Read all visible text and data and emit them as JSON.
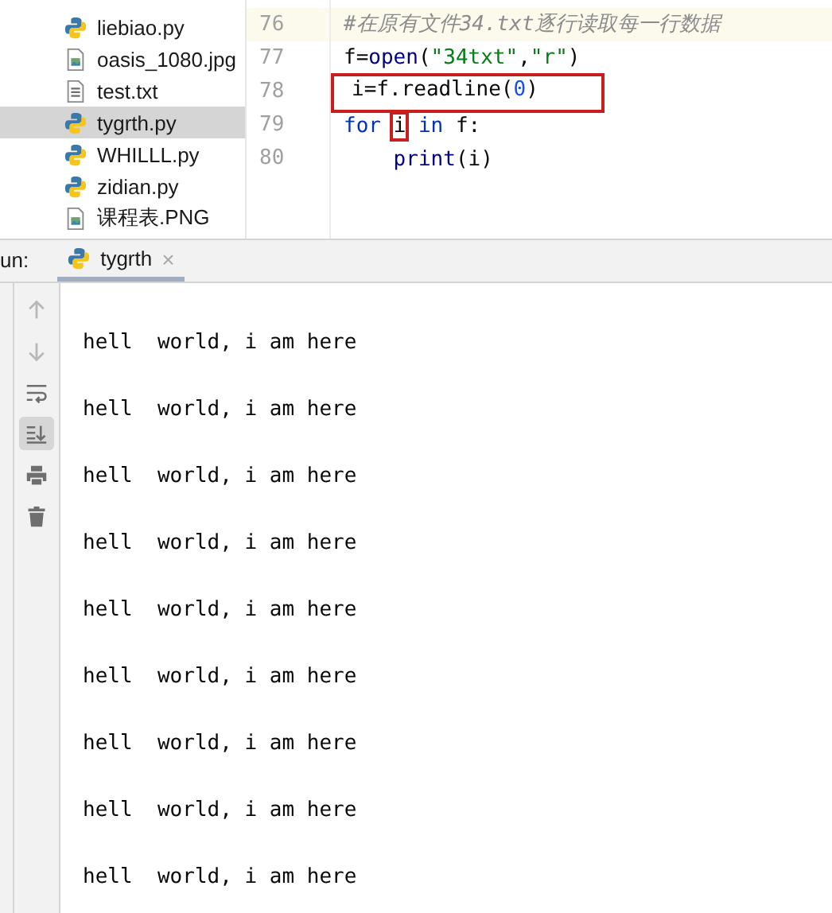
{
  "file_tree": {
    "items": [
      {
        "name": "liebiao.py",
        "kind": "python",
        "selected": false
      },
      {
        "name": "oasis_1080.jpg",
        "kind": "image",
        "selected": false
      },
      {
        "name": "test.txt",
        "kind": "text",
        "selected": false
      },
      {
        "name": "tygrth.py",
        "kind": "python",
        "selected": true
      },
      {
        "name": "WHILLL.py",
        "kind": "python",
        "selected": false
      },
      {
        "name": "zidian.py",
        "kind": "python",
        "selected": false
      },
      {
        "name": "课程表.PNG",
        "kind": "image",
        "selected": false
      }
    ]
  },
  "editor": {
    "lines": [
      {
        "number": "76",
        "current": true,
        "boxed": false,
        "tokens": [
          {
            "kind": "comment",
            "text": "#在原有文件34.txt逐行读取每一行数据",
            "boxed": false
          }
        ]
      },
      {
        "number": "77",
        "current": false,
        "boxed": false,
        "tokens": [
          {
            "kind": "plain",
            "text": "f=",
            "boxed": false
          },
          {
            "kind": "builtin",
            "text": "open",
            "boxed": false
          },
          {
            "kind": "plain",
            "text": "(",
            "boxed": false
          },
          {
            "kind": "string",
            "text": "\"34txt\"",
            "boxed": false
          },
          {
            "kind": "plain",
            "text": ",",
            "boxed": false
          },
          {
            "kind": "string",
            "text": "\"r\"",
            "boxed": false
          },
          {
            "kind": "plain",
            "text": ")",
            "boxed": false
          }
        ]
      },
      {
        "number": "78",
        "current": false,
        "boxed": true,
        "tokens": [
          {
            "kind": "plain",
            "text": "i=f.readline(",
            "boxed": false
          },
          {
            "kind": "number",
            "text": "0",
            "boxed": false
          },
          {
            "kind": "plain",
            "text": ")",
            "boxed": false
          }
        ]
      },
      {
        "number": "79",
        "current": false,
        "boxed": false,
        "tokens": [
          {
            "kind": "keyword",
            "text": "for ",
            "boxed": false
          },
          {
            "kind": "plain",
            "text": "i",
            "boxed": true
          },
          {
            "kind": "keyword",
            "text": " in",
            "boxed": false
          },
          {
            "kind": "plain",
            "text": " f:",
            "boxed": false
          }
        ],
        "children": [
          {
            "number": "80",
            "current": false,
            "boxed": false,
            "tokens": [
              {
                "kind": "builtin",
                "text": "print",
                "boxed": false
              },
              {
                "kind": "plain",
                "text": "(i)",
                "boxed": false
              }
            ]
          }
        ]
      }
    ]
  },
  "run_panel": {
    "label": "un:",
    "tabs": [
      {
        "title": "tygrth",
        "selected": true,
        "close": "×"
      }
    ],
    "toolbar": [
      {
        "kind": "up",
        "selected": false,
        "disabled": true
      },
      {
        "kind": "down",
        "selected": false,
        "disabled": true
      },
      {
        "kind": "wrap",
        "selected": false,
        "disabled": false
      },
      {
        "kind": "scroll-end",
        "selected": true,
        "disabled": false
      },
      {
        "kind": "print",
        "selected": false,
        "disabled": false
      },
      {
        "kind": "trash",
        "selected": false,
        "disabled": false
      }
    ],
    "output": [
      "hell  world, i am here",
      "hell  world, i am here",
      "hell  world, i am here",
      "hell  world, i am here",
      "hell  world, i am here",
      "hell  world, i am here",
      "hell  world, i am here",
      "hell  world, i am here",
      "hell  world, i am here"
    ]
  }
}
